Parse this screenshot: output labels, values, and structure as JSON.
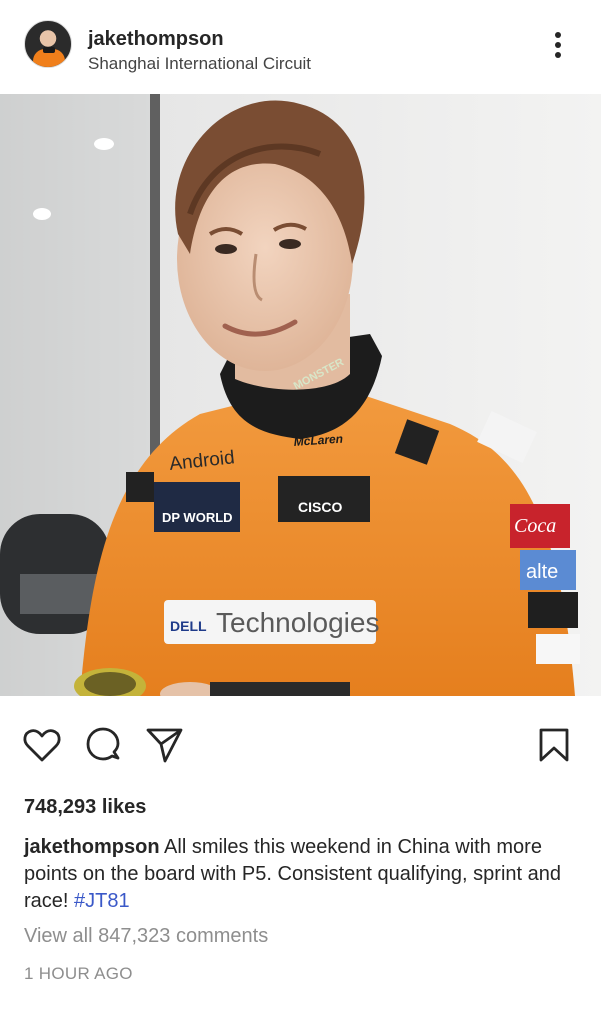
{
  "post": {
    "username": "jakethompson",
    "location": "Shanghai International Circuit",
    "likes": "748,293 likes",
    "caption_user": "jakethompson",
    "caption_text": " All smiles this weekend in China with more points on the board with P5. Consistent qualifying, sprint and race! ",
    "hashtag": "#JT81",
    "comments": "View all 847,323 comments",
    "time": "1 HOUR AGO"
  },
  "photo_text": {
    "android": "Android",
    "dp_world": "DP WORLD",
    "cisco": "CISCO",
    "mclaren": "McLaren",
    "monster": "MONSTER",
    "dell": "DELL",
    "technologies": "Technologies",
    "coca": "Coca",
    "alte": "alte"
  },
  "icons": {
    "more": "more-options-icon",
    "like": "heart-icon",
    "comment": "comment-icon",
    "share": "share-icon",
    "save": "bookmark-icon"
  },
  "colors": {
    "suit_orange": "#f28c2b",
    "hashtag": "#3a58c8",
    "muted": "#8e8e8e"
  }
}
